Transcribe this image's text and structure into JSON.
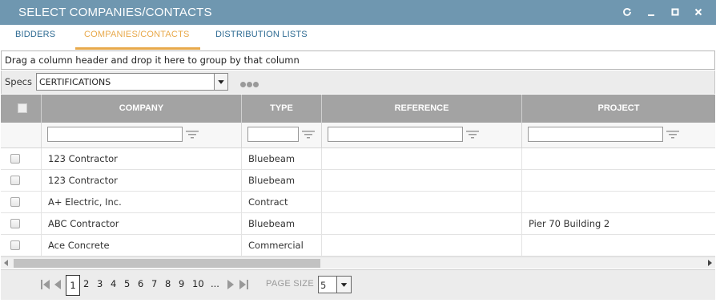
{
  "window": {
    "title": "SELECT COMPANIES/CONTACTS"
  },
  "tabs": [
    {
      "label": "BIDDERS",
      "active": false
    },
    {
      "label": "COMPANIES/CONTACTS",
      "active": true
    },
    {
      "label": "DISTRIBUTION LISTS",
      "active": false
    }
  ],
  "group_hint": "Drag a column header and drop it here to group by that column",
  "specs": {
    "label": "Specs",
    "selected": "CERTIFICATIONS"
  },
  "columns": [
    "COMPANY",
    "TYPE",
    "REFERENCE",
    "PROJECT"
  ],
  "rows": [
    {
      "company": "123 Contractor",
      "type": "Bluebeam",
      "reference": "",
      "project": ""
    },
    {
      "company": "123 Contractor",
      "type": "Bluebeam",
      "reference": "",
      "project": ""
    },
    {
      "company": "A+ Electric, Inc.",
      "type": "Contract",
      "reference": "",
      "project": ""
    },
    {
      "company": "ABC Contractor",
      "type": "Bluebeam",
      "reference": "",
      "project": "Pier 70 Building 2"
    },
    {
      "company": "Ace Concrete",
      "type": "Commercial",
      "reference": "",
      "project": ""
    }
  ],
  "pager": {
    "pages": [
      "1",
      "2",
      "3",
      "4",
      "5",
      "6",
      "7",
      "8",
      "9",
      "10",
      "..."
    ],
    "current": "1",
    "page_size_label": "PAGE SIZE",
    "page_size": "5"
  },
  "colors": {
    "titlebar": "#6f97b0",
    "tab_active": "#e8a94b",
    "tab": "#2e6b93",
    "header": "#a3a3a3"
  }
}
